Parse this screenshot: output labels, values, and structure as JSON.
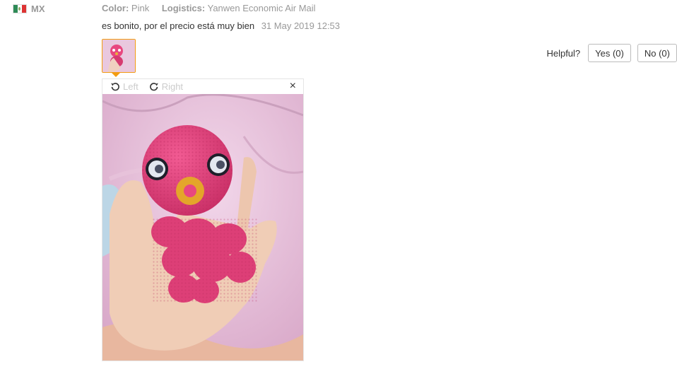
{
  "review": {
    "country_code": "MX",
    "color_label": "Color:",
    "color_value": "Pink",
    "logistics_label": "Logistics:",
    "logistics_value": "Yanwen Economic Air Mail",
    "comment": "es bonito, por el precio está muy bien",
    "date": "31 May 2019 12:53"
  },
  "helpful": {
    "label": "Helpful?",
    "yes": "Yes (0)",
    "no": "No (0)"
  },
  "viewer": {
    "left_label": "Left",
    "right_label": "Right",
    "close_symbol": "×"
  },
  "icons": [
    "mexico-flag-icon",
    "rotate-left-icon",
    "rotate-right-icon",
    "close-icon"
  ],
  "colors": {
    "accent": "#f39c12",
    "muted": "#999999",
    "toy": "#e8477f"
  }
}
